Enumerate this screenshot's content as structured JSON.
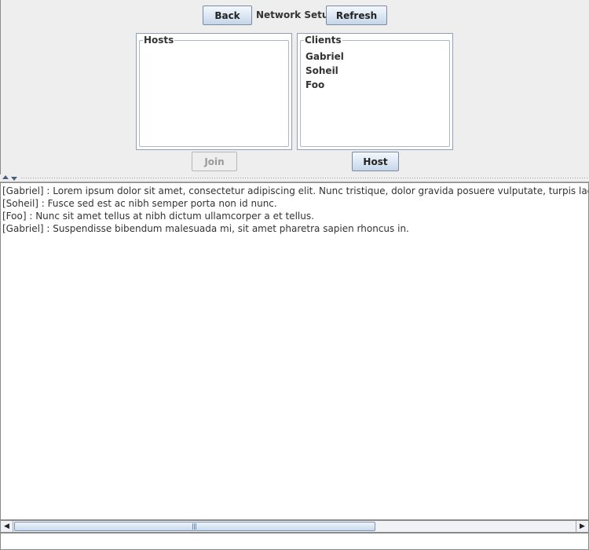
{
  "header": {
    "back_label": "Back",
    "title": "Network Setup",
    "refresh_label": "Refresh"
  },
  "hosts": {
    "title": "Hosts",
    "items": []
  },
  "clients": {
    "title": "Clients",
    "items": [
      "Gabriel",
      "Soheil",
      "Foo"
    ]
  },
  "actions": {
    "join_label": "Join",
    "join_enabled": false,
    "host_label": "Host"
  },
  "chat": {
    "lines": [
      "[Gabriel] : Lorem ipsum dolor sit amet, consectetur adipiscing elit. Nunc tristique, dolor gravida posuere vulputate, turpis lacus tristique el",
      "[Soheil] : Fusce sed est ac nibh semper porta non id nunc.",
      "[Foo] : Nunc sit amet tellus at nibh dictum ullamcorper a et tellus.",
      "[Gabriel] : Suspendisse bibendum malesuada mi, sit amet pharetra sapien rhoncus in."
    ]
  },
  "message_input": {
    "value": "",
    "placeholder": ""
  }
}
